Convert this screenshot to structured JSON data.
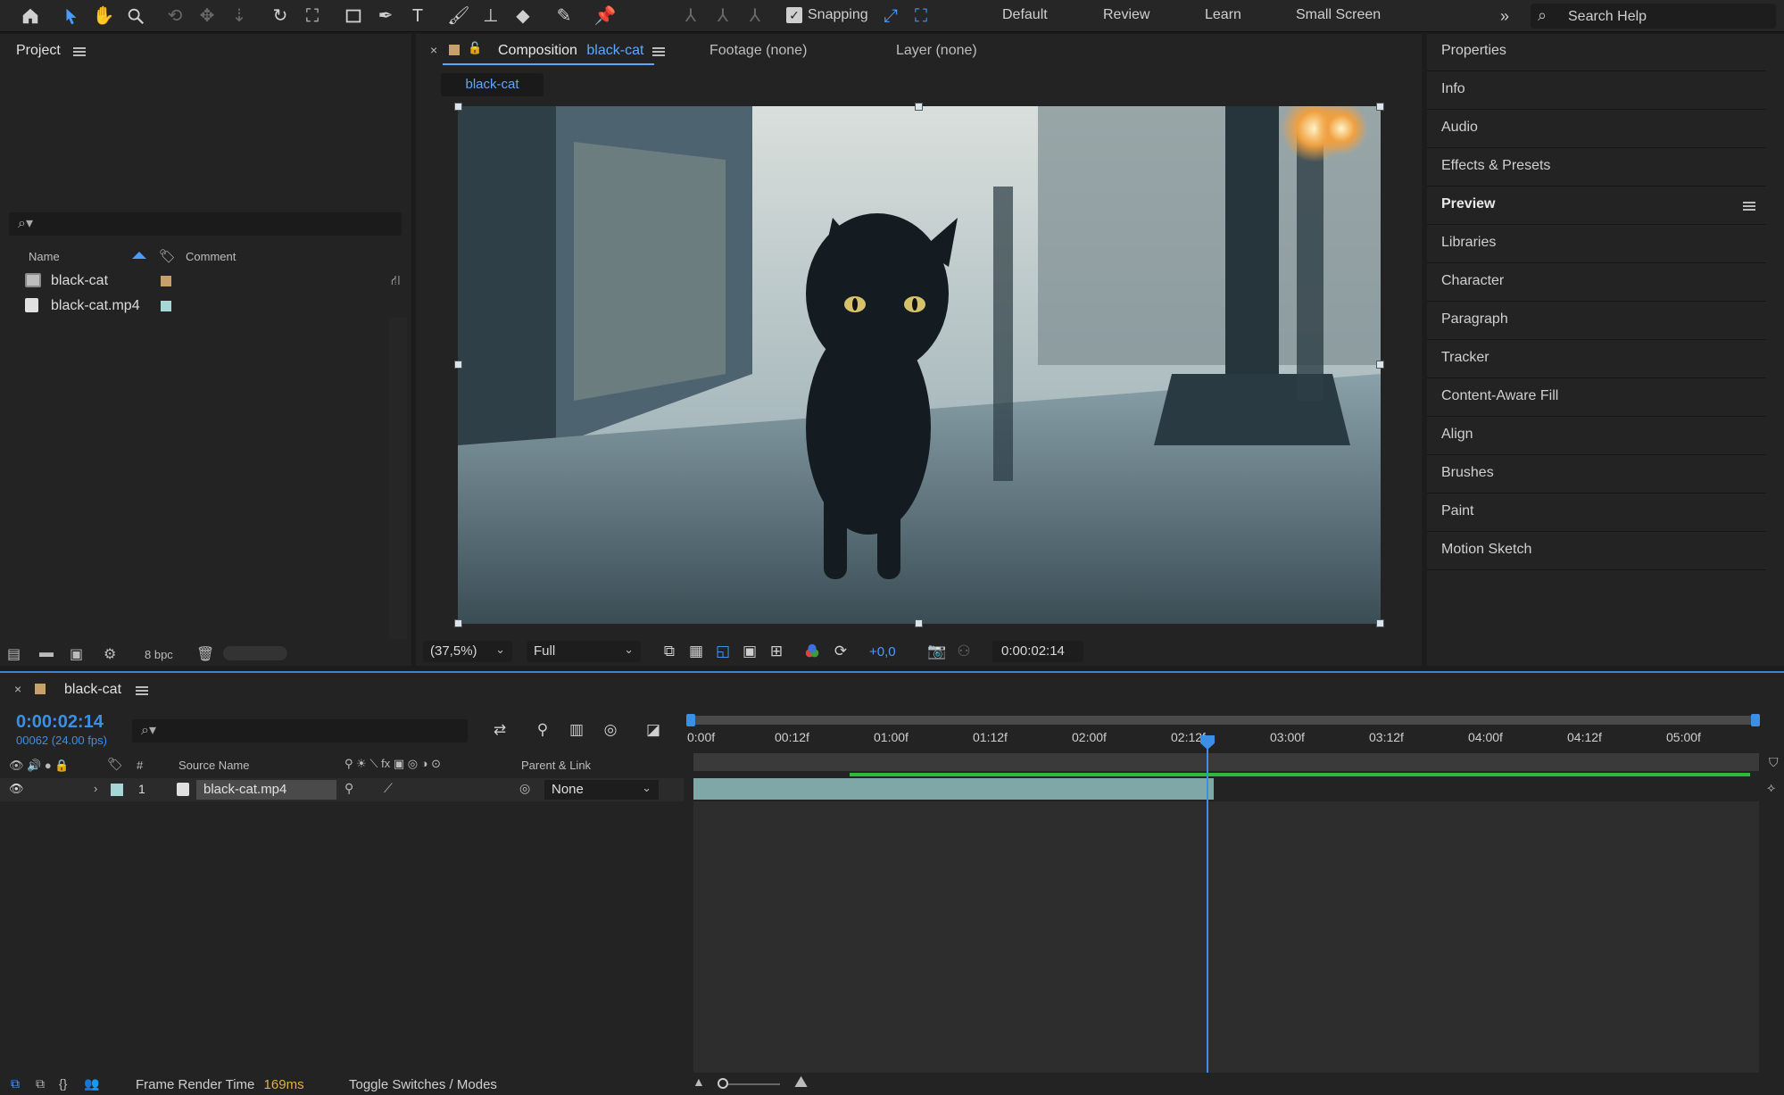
{
  "toolbar": {
    "snapping_label": "Snapping",
    "workspaces": [
      "Default",
      "Review",
      "Learn",
      "Small Screen"
    ],
    "search_placeholder": "Search Help"
  },
  "project": {
    "title": "Project",
    "columns": {
      "name": "Name",
      "comment": "Comment"
    },
    "items": [
      {
        "name": "black-cat",
        "type": "composition",
        "label_color": "#c8a06a"
      },
      {
        "name": "black-cat.mp4",
        "type": "footage",
        "label_color": "#a6d6d6"
      }
    ],
    "bit_depth": "8 bpc"
  },
  "composition": {
    "tab_prefix": "Composition",
    "tab_name": "black-cat",
    "footage_tab": "Footage (none)",
    "layer_tab": "Layer (none)",
    "subtab": "black-cat",
    "zoom": "(37,5%)",
    "resolution": "Full",
    "exposure": "+0,0",
    "current_time": "0:00:02:14"
  },
  "right_panels": [
    {
      "label": "Properties"
    },
    {
      "label": "Info"
    },
    {
      "label": "Audio"
    },
    {
      "label": "Effects & Presets"
    },
    {
      "label": "Preview",
      "active": true
    },
    {
      "label": "Libraries"
    },
    {
      "label": "Character"
    },
    {
      "label": "Paragraph"
    },
    {
      "label": "Tracker"
    },
    {
      "label": "Content-Aware Fill"
    },
    {
      "label": "Align"
    },
    {
      "label": "Brushes"
    },
    {
      "label": "Paint"
    },
    {
      "label": "Motion Sketch"
    }
  ],
  "timeline": {
    "comp_name": "black-cat",
    "timecode": "0:00:02:14",
    "frames": "00062 (24.00 fps)",
    "columns": {
      "index": "#",
      "source_name": "Source Name",
      "parent_link": "Parent & Link"
    },
    "layer": {
      "index": "1",
      "name": "black-cat.mp4",
      "parent": "None"
    },
    "ruler_labels": [
      "0:00f",
      "00:12f",
      "01:00f",
      "01:12f",
      "02:00f",
      "02:12f",
      "03:00f",
      "03:12f",
      "04:00f",
      "04:12f",
      "05:00f"
    ],
    "footer": {
      "render_label": "Frame Render Time",
      "render_value": "169ms",
      "toggle_label": "Toggle Switches / Modes"
    }
  }
}
